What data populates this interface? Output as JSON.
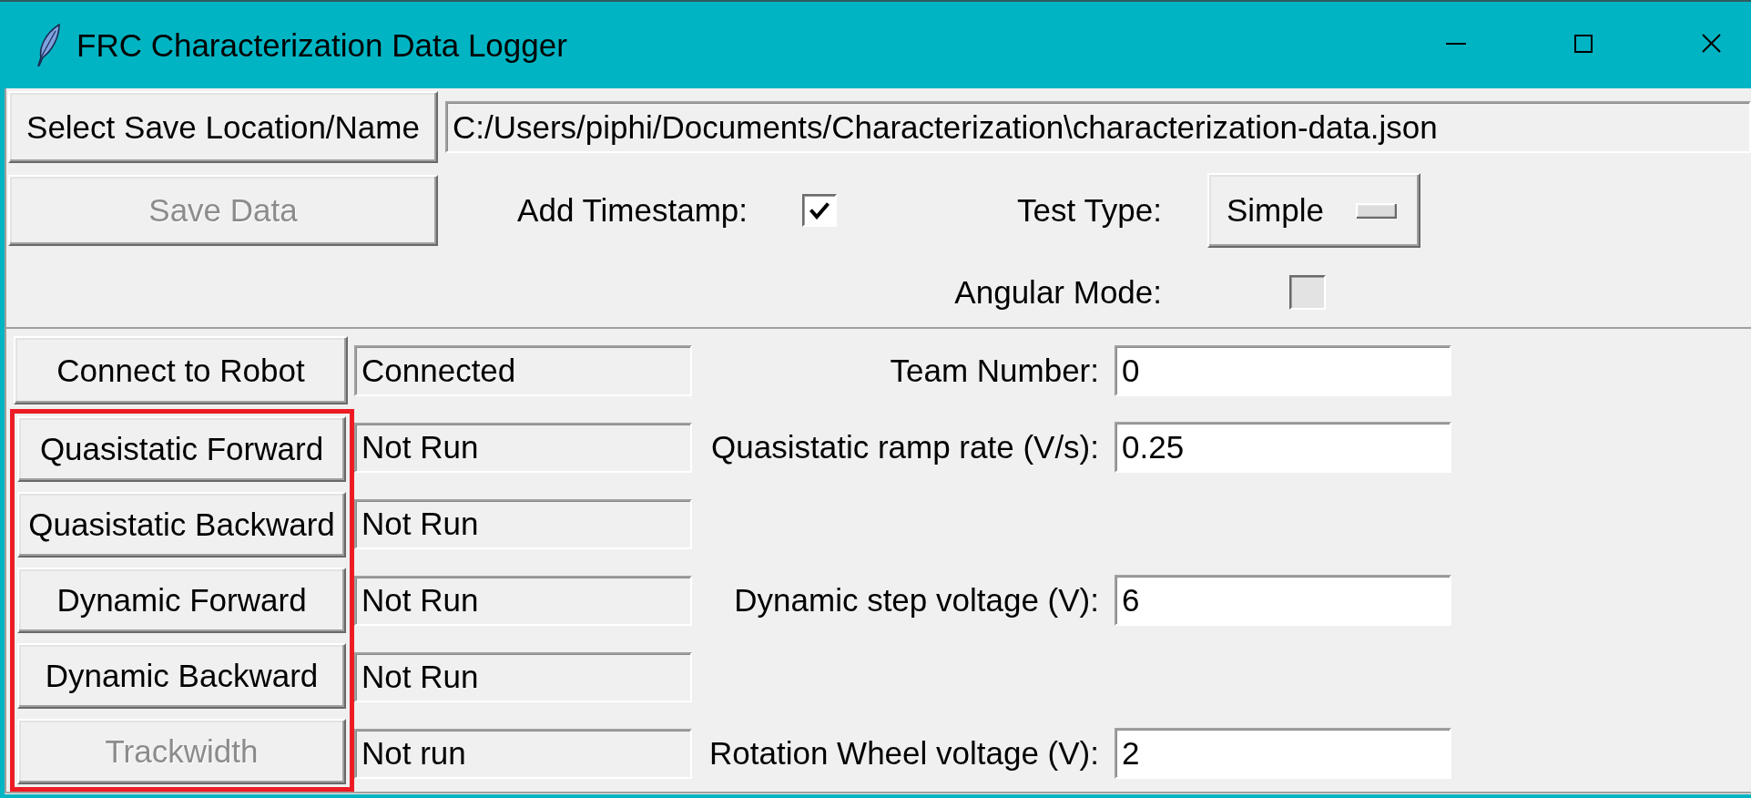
{
  "window": {
    "title": "FRC Characterization Data Logger"
  },
  "save_panel": {
    "select_button": {
      "label": "Select Save Location/Name",
      "disabled": false
    },
    "path_field": {
      "value": "C:/Users/piphi/Documents/Characterization\\characterization-data.json"
    },
    "save_button": {
      "label": "Save Data",
      "disabled": true
    },
    "add_timestamp": {
      "label": "Add Timestamp:",
      "checked": true,
      "disabled": false
    },
    "test_type": {
      "label": "Test Type:",
      "value": "Simple"
    },
    "angular_mode": {
      "label": "Angular Mode:",
      "checked": false,
      "disabled": true
    }
  },
  "test_panel": {
    "connection": {
      "button": {
        "label": "Connect to Robot",
        "disabled": false
      },
      "status": "Connected",
      "setting": {
        "label": "Team Number:",
        "value": "0"
      }
    },
    "tests_highlighted": true,
    "tests": [
      {
        "button": {
          "label": "Quasistatic Forward",
          "disabled": false
        },
        "status": "Not Run",
        "setting": {
          "label": "Quasistatic ramp rate (V/s):",
          "value": "0.25"
        }
      },
      {
        "button": {
          "label": "Quasistatic Backward",
          "disabled": false
        },
        "status": "Not Run"
      },
      {
        "button": {
          "label": "Dynamic Forward",
          "disabled": false
        },
        "status": "Not Run",
        "setting": {
          "label": "Dynamic step voltage (V):",
          "value": "6"
        }
      },
      {
        "button": {
          "label": "Dynamic Backward",
          "disabled": false
        },
        "status": "Not Run"
      },
      {
        "button": {
          "label": "Trackwidth",
          "disabled": true
        },
        "status": "Not run",
        "setting": {
          "label": "Rotation Wheel voltage (V):",
          "value": "2"
        }
      }
    ]
  }
}
